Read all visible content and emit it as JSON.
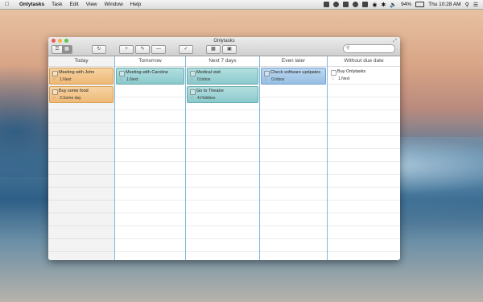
{
  "menubar": {
    "app_name": "Onlytasks",
    "menus": [
      "Task",
      "Edit",
      "View",
      "Window",
      "Help"
    ],
    "battery": "94%",
    "clock": "Thu 10:28 AM"
  },
  "window": {
    "title": "Onlytasks",
    "search": {
      "placeholder": ""
    }
  },
  "columns": [
    {
      "label": "Today"
    },
    {
      "label": "Tomorrow"
    },
    {
      "label": "Next 7 days"
    },
    {
      "label": "Even later"
    },
    {
      "label": "Without due date"
    }
  ],
  "tasks": [
    {
      "title": "Meeting with John",
      "project": "1.Next",
      "color": "orange"
    },
    {
      "title": "Buy some food",
      "project": "3.Some day",
      "color": "orange"
    },
    {
      "title": "Meeting with Caroline",
      "project": "1.Next",
      "color": "teal"
    },
    {
      "title": "Medical visit",
      "project": "0.Inbox",
      "color": "teal"
    },
    {
      "title": "Go to Theatre",
      "project": "4.Hobbies",
      "color": "teal"
    },
    {
      "title": "Check software updpates",
      "project": "0.Inbox",
      "color": "blue"
    },
    {
      "title": "Buy Onlytasks",
      "project": "1.Next",
      "color": "white"
    }
  ],
  "colors": {
    "orange": "#eeb977",
    "teal": "#8bc9cc",
    "blue": "#97bfe3",
    "column_divider": "#7fb7dc"
  }
}
